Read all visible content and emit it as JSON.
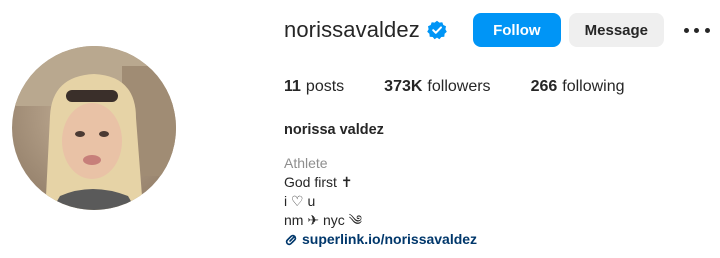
{
  "profile": {
    "username": "norissavaldez",
    "full_name": "norissa valdez",
    "follow_label": "Follow",
    "message_label": "Message"
  },
  "stats": [
    {
      "value": "11",
      "label": "posts"
    },
    {
      "value": "373K",
      "label": "followers"
    },
    {
      "value": "266",
      "label": "following"
    }
  ],
  "bio": {
    "category": "Athlete",
    "lines": [
      "God first ✝",
      "i ♡ u",
      "nm ✈ nyc ༄"
    ],
    "link": "superlink.io/norissavaldez"
  },
  "icons": {
    "verified": "verified-badge-icon",
    "more": "more-options-icon",
    "link": "link-icon"
  },
  "colors": {
    "follow_button": "#0095f6",
    "message_button": "#efefef",
    "verified": "#0095f6",
    "link": "#00376b",
    "muted": "#8e8e8e"
  }
}
